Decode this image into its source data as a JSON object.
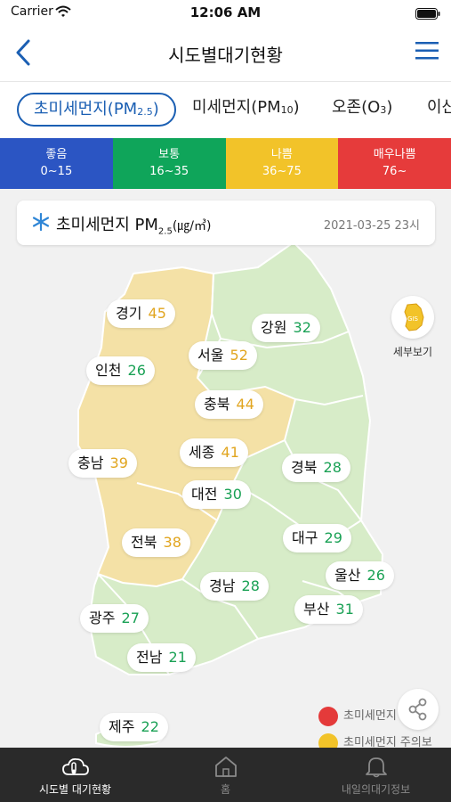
{
  "status": {
    "carrier": "Carrier",
    "time": "12:06 AM"
  },
  "nav": {
    "title": "시도별대기현황",
    "back_icon": "chevron-left-icon",
    "menu_icon": "hamburger-menu-icon",
    "accent": "#1b5fb3"
  },
  "tabs": {
    "pm25": {
      "label": "초미세먼지(PM",
      "sub": "2.5",
      "close": ")"
    },
    "pm10": {
      "label": "미세먼지(PM",
      "sub": "10",
      "close": ")"
    },
    "ozone": {
      "label": "오존(O",
      "sub": "3",
      "close": ")"
    },
    "more": {
      "label": "이산"
    }
  },
  "legend": [
    {
      "label": "좋음",
      "range": "0~15",
      "color": "#2b55c3"
    },
    {
      "label": "보통",
      "range": "16~35",
      "color": "#0fa55a"
    },
    {
      "label": "나쁨",
      "range": "36~75",
      "color": "#f2c329"
    },
    {
      "label": "매우나쁨",
      "range": "76~",
      "color": "#e63b3b"
    }
  ],
  "info": {
    "title": "초미세먼지 PM",
    "sub": "2.5",
    "unit": "(㎍/㎥)",
    "timestamp": "2021-03-25 23시"
  },
  "regions": {
    "gyeonggi": {
      "name": "경기",
      "value": "45",
      "level": "yellow"
    },
    "gangwon": {
      "name": "강원",
      "value": "32",
      "level": "green"
    },
    "seoul": {
      "name": "서울",
      "value": "52",
      "level": "yellow"
    },
    "incheon": {
      "name": "인천",
      "value": "26",
      "level": "green"
    },
    "chungbuk": {
      "name": "충북",
      "value": "44",
      "level": "yellow"
    },
    "sejong": {
      "name": "세종",
      "value": "41",
      "level": "yellow"
    },
    "chungnam": {
      "name": "충남",
      "value": "39",
      "level": "yellow"
    },
    "gyeongbuk": {
      "name": "경북",
      "value": "28",
      "level": "green"
    },
    "daejeon": {
      "name": "대전",
      "value": "30",
      "level": "green"
    },
    "jeonbuk": {
      "name": "전북",
      "value": "38",
      "level": "yellow"
    },
    "daegu": {
      "name": "대구",
      "value": "29",
      "level": "green"
    },
    "ulsan": {
      "name": "울산",
      "value": "26",
      "level": "green"
    },
    "gyeongnam": {
      "name": "경남",
      "value": "28",
      "level": "green"
    },
    "busan": {
      "name": "부산",
      "value": "31",
      "level": "green"
    },
    "gwangju": {
      "name": "광주",
      "value": "27",
      "level": "green"
    },
    "jeonnam": {
      "name": "전남",
      "value": "21",
      "level": "green"
    },
    "jeju": {
      "name": "제주",
      "value": "22",
      "level": "green"
    }
  },
  "map_colors": {
    "good_fill": "#d7ecc8",
    "moderate_fill": "#f4e1a6",
    "border": "#ffffff"
  },
  "detail_button": {
    "label": "세부보기",
    "icon": "korea-map-icon",
    "icon_text": "GIS"
  },
  "share": {
    "icon": "share-icon"
  },
  "map_legend": [
    {
      "label": "초미세먼지",
      "color": "#e43a3a",
      "icon": "megaphone-icon"
    },
    {
      "label": "초미세먼지 주의보",
      "color": "#f2c329",
      "icon": "megaphone-icon"
    }
  ],
  "bottom_tabs": [
    {
      "label": "시도별 대기현황",
      "icon": "cloud-thermometer-icon",
      "active": true
    },
    {
      "label": "홈",
      "icon": "home-icon",
      "active": false
    },
    {
      "label": "내일의대기정보",
      "icon": "bell-icon",
      "active": false
    }
  ]
}
